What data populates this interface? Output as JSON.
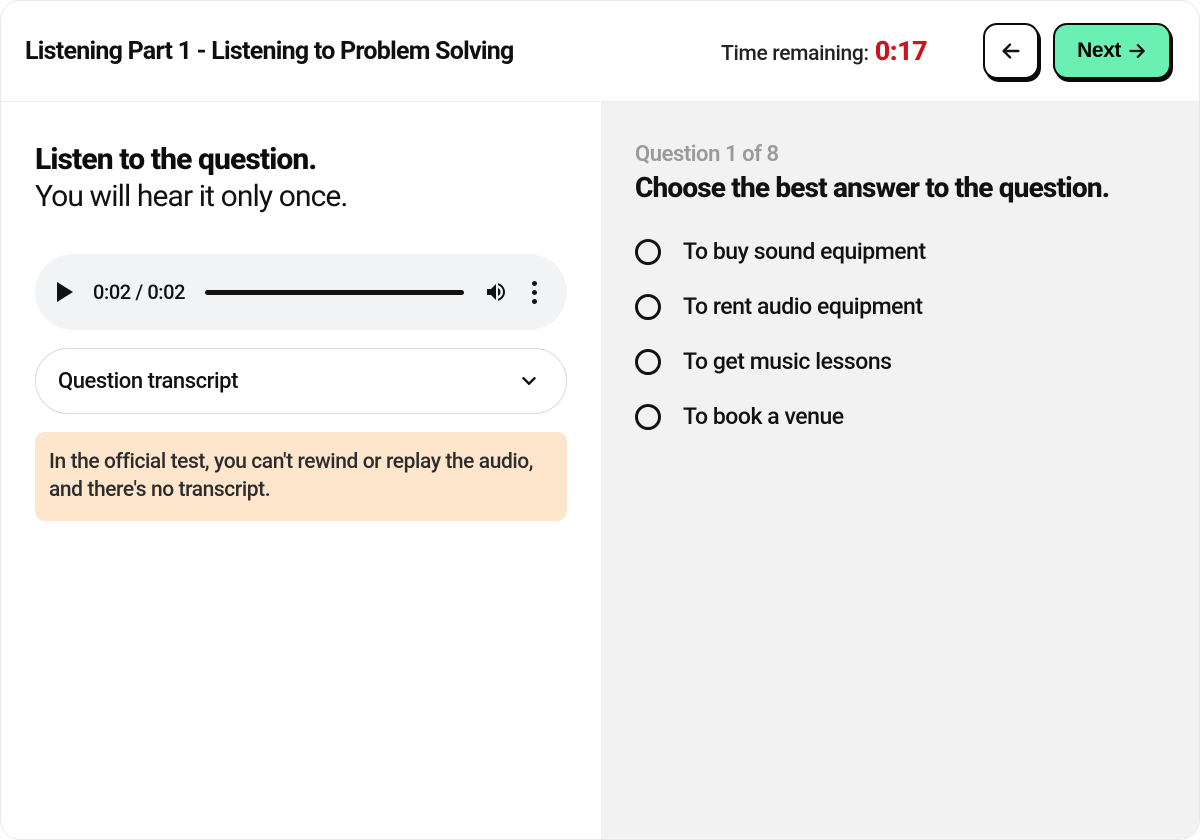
{
  "header": {
    "title": "Listening Part 1 - Listening to Problem Solving",
    "timer_label": "Time remaining:",
    "timer_value": "0:17",
    "next_label": "Next"
  },
  "left": {
    "heading": "Listen to the question.",
    "subheading": "You will hear it only once.",
    "audio": {
      "current": "0:02",
      "total": "0:02"
    },
    "transcript_label": "Question transcript",
    "notice": "In the official test, you can't rewind or replay the audio, and there's no transcript."
  },
  "right": {
    "index": "Question 1 of 8",
    "prompt": "Choose the best answer to the question.",
    "options": [
      "To buy sound equipment",
      "To rent audio equipment",
      "To get music lessons",
      "To book a venue"
    ]
  }
}
